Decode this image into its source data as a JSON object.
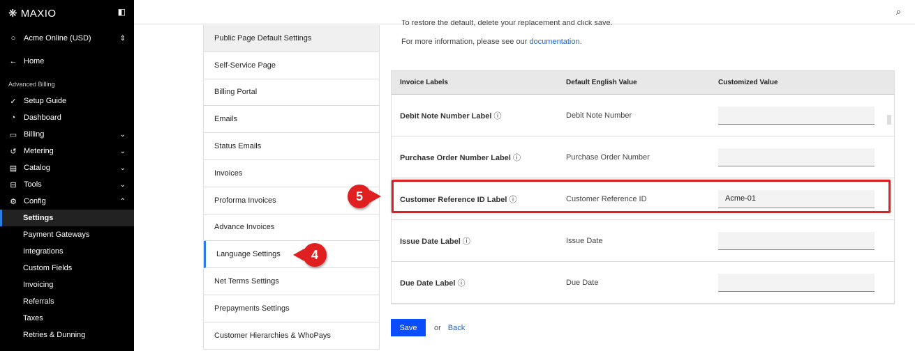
{
  "sidebar": {
    "brand": "MAXIO",
    "account": "Acme Online (USD)",
    "home": "Home",
    "section": "Advanced Billing",
    "items": [
      {
        "label": "Setup Guide",
        "icon": "check-circle"
      },
      {
        "label": "Dashboard",
        "icon": "gauge"
      },
      {
        "label": "Billing",
        "icon": "card"
      },
      {
        "label": "Metering",
        "icon": "history"
      },
      {
        "label": "Catalog",
        "icon": "book"
      },
      {
        "label": "Tools",
        "icon": "toolbox"
      },
      {
        "label": "Config",
        "icon": "gear"
      }
    ],
    "sub": [
      "Settings",
      "Payment Gateways",
      "Integrations",
      "Custom Fields",
      "Invoicing",
      "Referrals",
      "Taxes",
      "Retries & Dunning"
    ]
  },
  "menu": [
    "Public Page Default Settings",
    "Self-Service Page",
    "Billing Portal",
    "Emails",
    "Status Emails",
    "Invoices",
    "Proforma Invoices",
    "Advance Invoices",
    "Language Settings",
    "Net Terms Settings",
    "Prepayments Settings",
    "Customer Hierarchies & WhoPays"
  ],
  "content": {
    "restore": "To restore the default, delete your replacement and click save.",
    "info": "For more information, please see our",
    "doc_link": "documentation",
    "period": "."
  },
  "table": {
    "headers": [
      "Invoice Labels",
      "Default English Value",
      "Customized Value"
    ],
    "rows": [
      {
        "label": "Debit Note Number Label",
        "default": "Debit Note Number",
        "value": ""
      },
      {
        "label": "Purchase Order Number Label",
        "default": "Purchase Order Number",
        "value": ""
      },
      {
        "label": "Customer Reference ID Label",
        "default": "Customer Reference ID",
        "value": "Acme-01"
      },
      {
        "label": "Issue Date Label",
        "default": "Issue Date",
        "value": ""
      },
      {
        "label": "Due Date Label",
        "default": "Due Date",
        "value": ""
      }
    ]
  },
  "actions": {
    "save": "Save",
    "or": "or",
    "back": "Back"
  },
  "annotations": {
    "step4": "4",
    "step5": "5"
  }
}
